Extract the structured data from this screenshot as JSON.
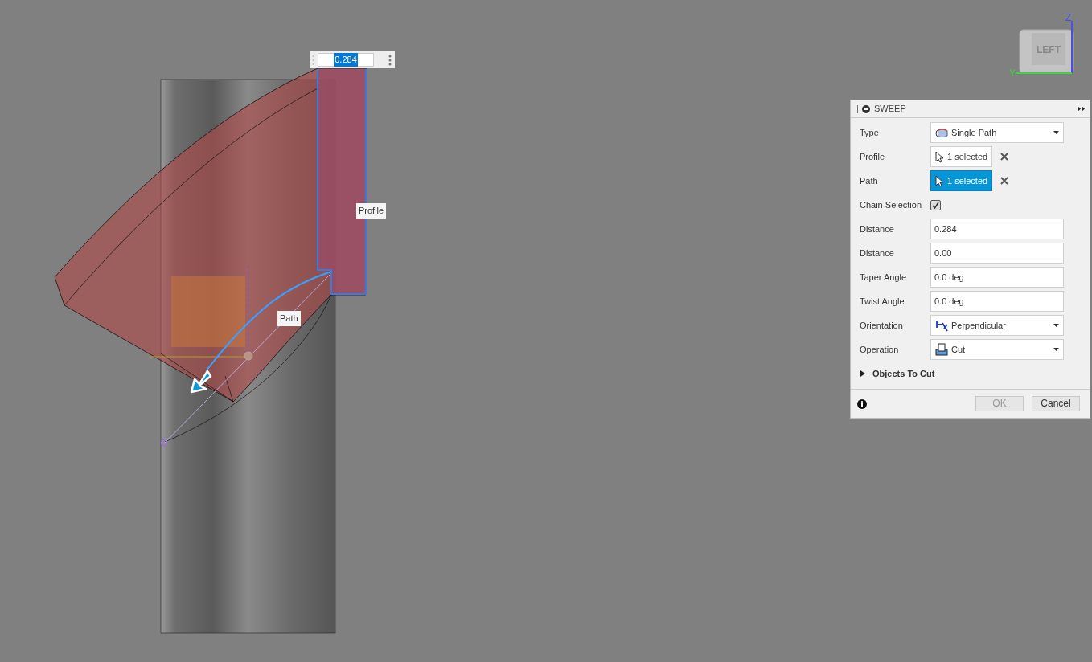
{
  "viewport": {
    "value_box": {
      "value": "0.284"
    },
    "labels": [
      {
        "text": "Profile"
      },
      {
        "text": "Path"
      }
    ],
    "view_cube": {
      "face": "LEFT",
      "axes": [
        "Z",
        "Y"
      ]
    }
  },
  "panel": {
    "title": "SWEEP",
    "rows": [
      {
        "kind": "select",
        "label": "Type",
        "value": "Single Path"
      },
      {
        "kind": "selection",
        "label": "Profile",
        "value": "1 selected",
        "selected": false
      },
      {
        "kind": "selection",
        "label": "Path",
        "value": "1 selected",
        "selected": true
      },
      {
        "kind": "checkbox",
        "label": "Chain Selection",
        "checked": true
      },
      {
        "kind": "input",
        "label": "Distance",
        "value": "0.284"
      },
      {
        "kind": "input",
        "label": "Distance",
        "value": "0.00"
      },
      {
        "kind": "input",
        "label": "Taper Angle",
        "value": "0.0 deg"
      },
      {
        "kind": "input",
        "label": "Twist Angle",
        "value": "0.0 deg"
      },
      {
        "kind": "select",
        "label": "Orientation",
        "value": "Perpendicular"
      },
      {
        "kind": "select",
        "label": "Operation",
        "value": "Cut"
      }
    ],
    "section": {
      "label": "Objects To Cut",
      "expanded": false
    },
    "buttons": [
      {
        "label": "OK",
        "disabled": true
      },
      {
        "label": "Cancel",
        "disabled": false
      }
    ]
  }
}
